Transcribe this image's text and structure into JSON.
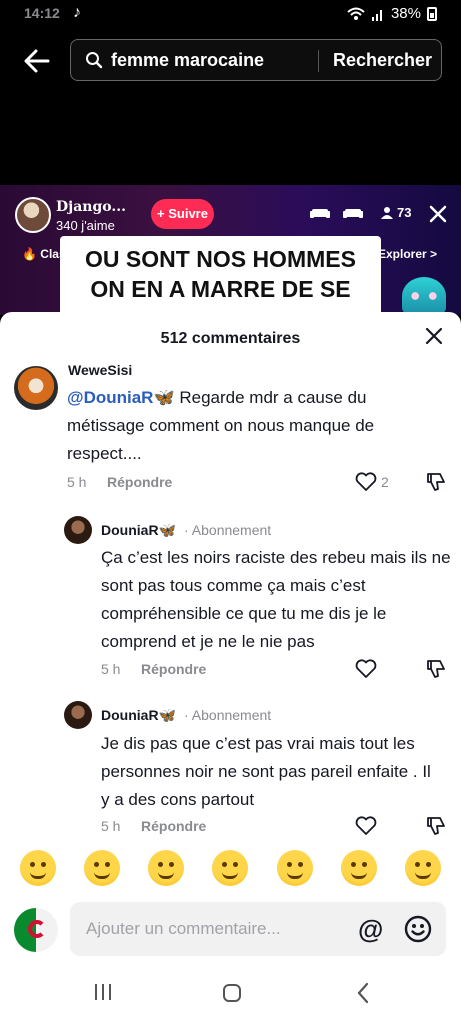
{
  "status": {
    "time": "14:12",
    "battery": "38%",
    "app_icon": "tiktok-icon"
  },
  "search": {
    "query": "femme marocaine",
    "button": "Rechercher"
  },
  "live": {
    "host_name": "Django...",
    "host_likes": "340 j'aime",
    "follow_label": "+ Suivre",
    "viewer_count": "73",
    "category_left": "Clas",
    "explore": "Explorer >",
    "banner_line1": "OU SONT NOS HOMMES",
    "banner_line2": "ON EN A MARRE DE SE"
  },
  "comments_panel": {
    "title": "512 commentaires",
    "comments": [
      {
        "user": "WeweSisi",
        "mention": "@DouniaR🦋",
        "text": " Regarde mdr a cause du métissage comment on nous manque de respect....",
        "time": "5 h",
        "reply": "Répondre",
        "likes": "2"
      },
      {
        "user": "DouniaR🦋",
        "tag": "· Abonnement",
        "text": "Ça c’est les noirs raciste des rebeu mais ils ne sont pas tous comme ça mais c’est compréhensible ce que tu me dis je le comprend et je ne le nie pas",
        "time": "5 h",
        "reply": "Répondre"
      },
      {
        "user": "DouniaR🦋",
        "tag": "· Abonnement",
        "text": "Je dis pas que c’est pas vrai mais tout les personnes noir ne sont pas pareil enfaite . Il y a des cons partout",
        "time": "5 h",
        "reply": "Répondre"
      }
    ]
  },
  "emoji_bar": [
    "grinning",
    "smiling-hearts",
    "tears-of-joy",
    "flushed",
    "smirking",
    "grinning-sweat",
    "pleading"
  ],
  "input": {
    "placeholder": "Ajouter un commentaire...",
    "mention_symbol": "@"
  },
  "colors": {
    "accent": "#fe2c55",
    "mention": "#2b5db9",
    "muted": "#8a8b91"
  }
}
